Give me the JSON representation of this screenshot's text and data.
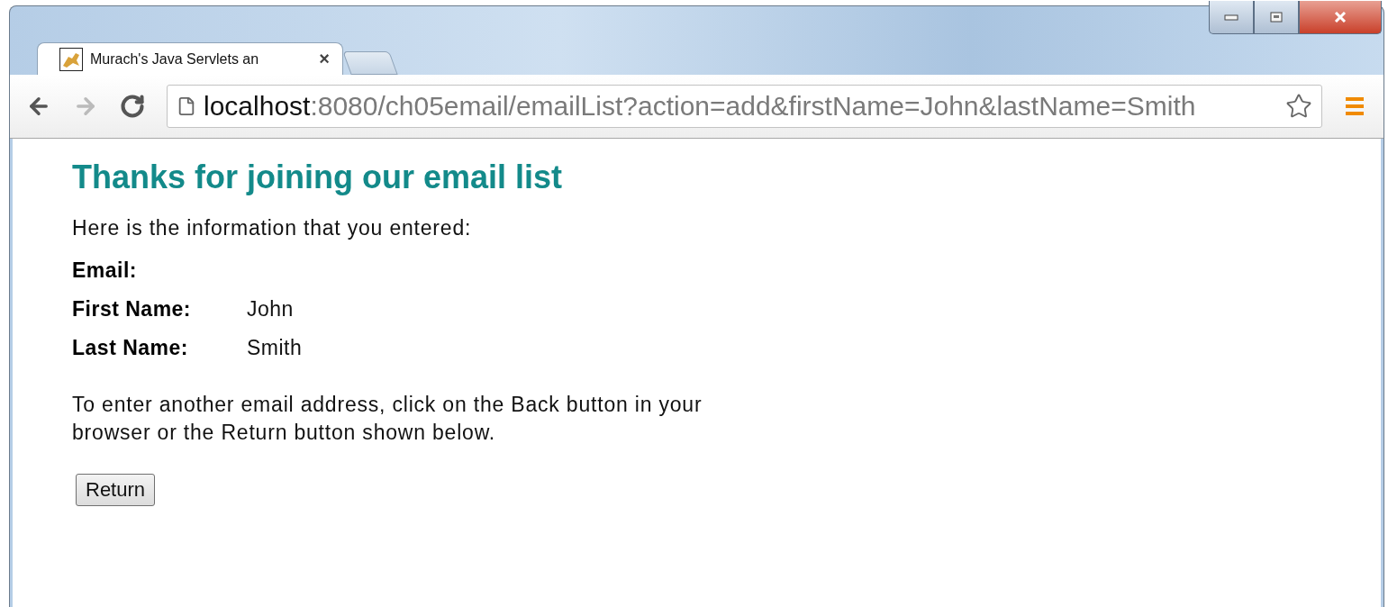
{
  "browser": {
    "tab": {
      "title": "Murach's Java Servlets an",
      "close": "×",
      "selected": true
    },
    "toolbar": {
      "back": {
        "disabled": false
      },
      "forward": {
        "disabled": true
      },
      "url_host": "localhost",
      "url_rest": ":8080/ch05email/emailList?action=add&firstName=John&lastName=Smith"
    }
  },
  "page": {
    "heading": "Thanks for joining our email list",
    "intro": "Here is the information that you entered:",
    "fields": [
      {
        "label": "Email:"
      },
      {
        "label": "First Name:",
        "value": "John"
      },
      {
        "label": "Last Name:",
        "value": "Smith"
      }
    ],
    "instructions": "To enter another email address, click on the Back button in your browser or the Return button shown below.",
    "button": "Return"
  }
}
